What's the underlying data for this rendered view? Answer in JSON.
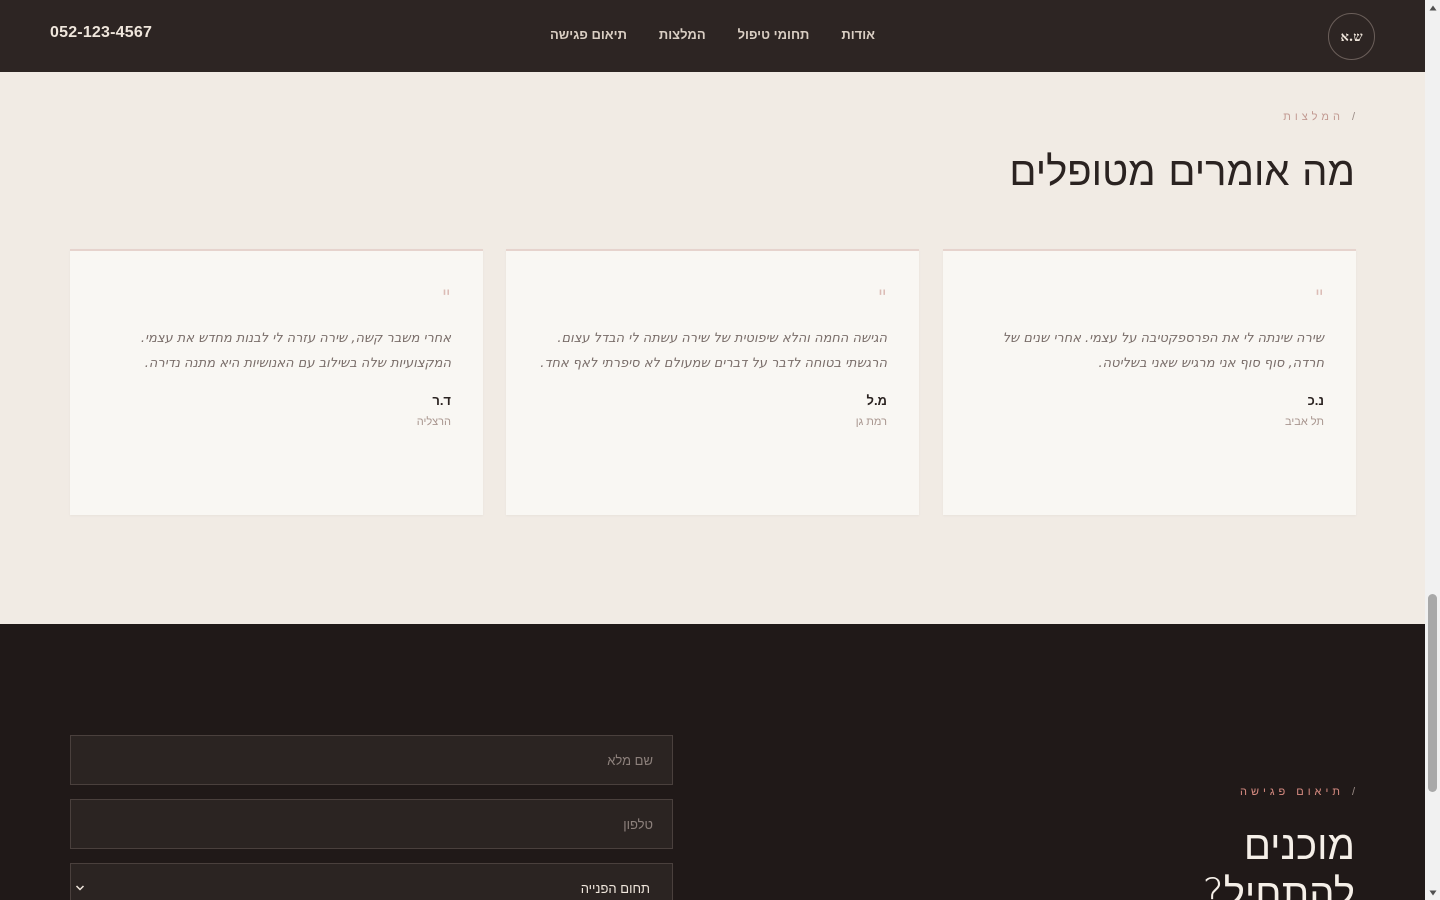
{
  "header": {
    "phone": "052-123-4567",
    "logo_text": "ש.א",
    "nav": [
      "אודות",
      "תחומי טיפול",
      "המלצות",
      "תיאום פגישה"
    ]
  },
  "testimonials": {
    "eyebrow": "המלצות",
    "eyebrow_separator": "/",
    "title": "מה אומרים מטופלים",
    "quote_mark": "\"",
    "items": [
      {
        "text": "שירה שינתה לי את הפרספקטיבה על עצמי. אחרי שנים של חרדה, סוף סוף אני מרגיש שאני בשליטה.",
        "name": "נ.כ",
        "city": "תל אביב"
      },
      {
        "text": "הגישה החמה והלא שיפוטית של שירה עשתה לי הבדל עצום. הרגשתי בטוחה לדבר על דברים שמעולם לא סיפרתי לאף אחד.",
        "name": "מ.ל",
        "city": "רמת גן"
      },
      {
        "text": "אחרי משבר קשה, שירה עזרה לי לבנות מחדש את עצמי. המקצועיות שלה בשילוב עם האנושיות היא מתנה נדירה.",
        "name": "ד.ר",
        "city": "הרצליה"
      }
    ]
  },
  "contact": {
    "eyebrow": "תיאום פגישה",
    "eyebrow_separator": "/",
    "title": "מוכנים להתחיל?",
    "form": {
      "name_placeholder": "שם מלא",
      "phone_placeholder": "טלפון",
      "topic_selected": "תחום הפנייה"
    }
  },
  "colors": {
    "header_bg": "#2d2523",
    "section_bg": "#f1ebe4",
    "card_bg": "#f9f7f3",
    "accent": "#d98c82",
    "contact_bg": "#201918"
  }
}
